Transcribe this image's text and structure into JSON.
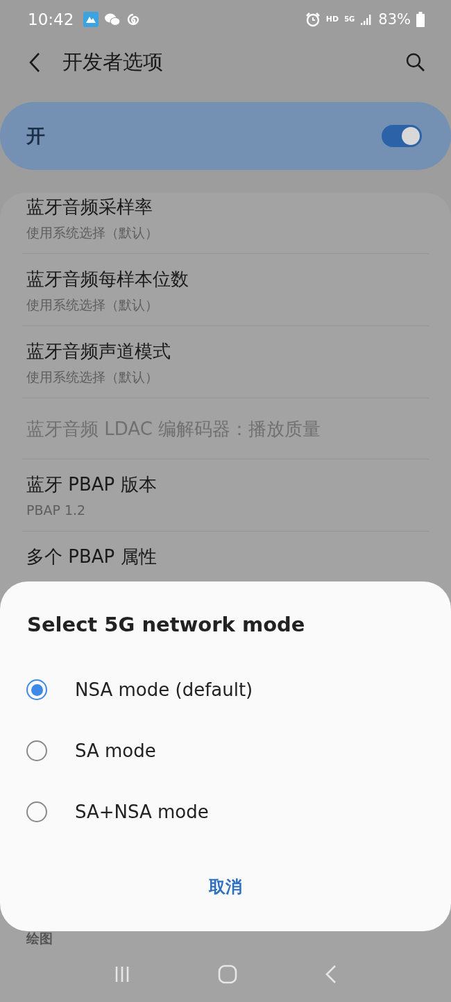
{
  "status_bar": {
    "time": "10:42",
    "hd_label": "HD",
    "network_label": "5G",
    "battery": "83%"
  },
  "header": {
    "title": "开发者选项"
  },
  "master_switch": {
    "label": "开",
    "on": true
  },
  "settings": [
    {
      "title": "蓝牙音频采样率",
      "summary": "使用系统选择（默认）",
      "disabled": false
    },
    {
      "title": "蓝牙音频每样本位数",
      "summary": "使用系统选择（默认）",
      "disabled": false
    },
    {
      "title": "蓝牙音频声道模式",
      "summary": "使用系统选择（默认）",
      "disabled": false
    },
    {
      "title": "蓝牙音频 LDAC 编解码器：播放质量",
      "disabled": true
    },
    {
      "title": "蓝牙 PBAP 版本",
      "summary": "PBAP 1.2",
      "disabled": false
    },
    {
      "title": "多个 PBAP 属性",
      "disabled": false
    }
  ],
  "section_header": "绘图",
  "dialog": {
    "title": "Select 5G network mode",
    "options": [
      {
        "label": "NSA mode (default)",
        "selected": true
      },
      {
        "label": "SA mode",
        "selected": false
      },
      {
        "label": "SA+NSA mode",
        "selected": false
      }
    ],
    "cancel": "取消"
  }
}
